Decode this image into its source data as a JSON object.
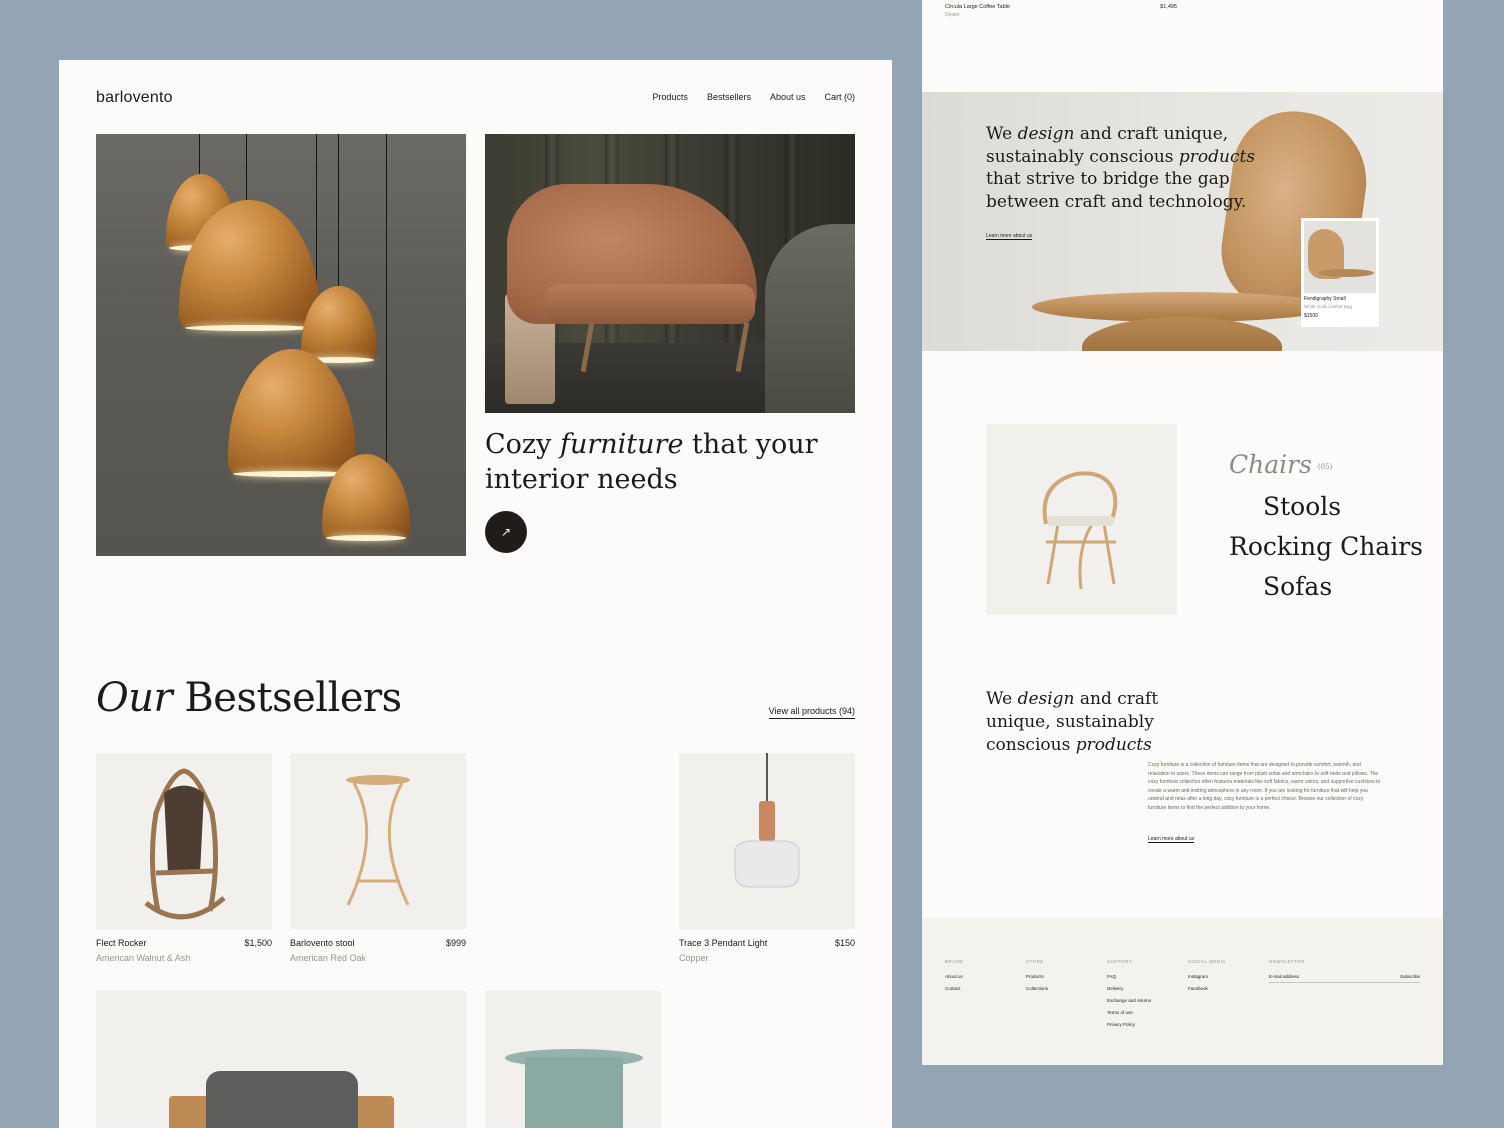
{
  "left": {
    "logo": "barlovento",
    "nav": [
      "Products",
      "Bestsellers",
      "About us",
      "Cart (0)"
    ],
    "hero": {
      "title_pre": "Cozy ",
      "title_italic": "furniture",
      "title_post": " that your interior needs",
      "arrow": "↗"
    },
    "bestsellers": {
      "title_italic": "Our",
      "title_rest": " Bestsellers",
      "view_all": "View all products (94)",
      "products": [
        {
          "name": "Flect Rocker",
          "price": "$1,500",
          "material": "American Walnut & Ash"
        },
        {
          "name": "Barlovento stool",
          "price": "$999",
          "material": "American Red Oak"
        },
        {
          "name": "Trace 3 Pendant Light",
          "price": "$150",
          "material": "Copper"
        }
      ]
    }
  },
  "right": {
    "top_item": {
      "name": "Circula Large Coffee Table",
      "price": "$1,495",
      "material": "Oyster"
    },
    "banner": {
      "t1": "We ",
      "t2": "design",
      "t3": " and craft unique, sustainably conscious ",
      "t4": "products",
      "t5": " that strive to bridge the gap between craft and technology.",
      "link": "Learn more about us",
      "mini_card": {
        "name": "Fendigraphy Small",
        "material": "White Gold Leather Bag",
        "price": "$1500"
      }
    },
    "categories": {
      "active": "Chairs",
      "active_count": "(05)",
      "items": [
        "Stools",
        "Rocking Chairs",
        "Sofas"
      ]
    },
    "about": {
      "h1": "We ",
      "h2": "design",
      "h3": " and craft unique, sustainably conscious ",
      "h4": "products",
      "body": "Cozy furniture is a collection of furniture items that are designed to provide comfort, warmth, and relaxation to users. These items can range from plush sofas and armchairs to soft beds and pillows. The cozy furniture collection often features materials like soft fabrics, warm colors, and supportive cushions to create a warm and inviting atmosphere in any room. If you are looking for furniture that will help you unwind and relax after a long day, cozy furniture is a perfect choice. Browse our collection of cozy furniture items to find the perfect addition to your home.",
      "link": "Learn more about us"
    },
    "footer": {
      "columns": [
        {
          "heading": "BRAND",
          "links": [
            "About us",
            "Contact"
          ]
        },
        {
          "heading": "STORE",
          "links": [
            "Products",
            "Collections"
          ]
        },
        {
          "heading": "SUPPORT",
          "links": [
            "FAQ",
            "Delivery",
            "Exchange and returns",
            "Terms of use",
            "Privacy Policy"
          ]
        },
        {
          "heading": "SOCIAL MEDIA",
          "links": [
            "Instagram",
            "Facebook"
          ]
        }
      ],
      "newsletter": {
        "heading": "NEWSLETTER",
        "placeholder": "E-mail address",
        "button": "Subscribe"
      }
    }
  }
}
